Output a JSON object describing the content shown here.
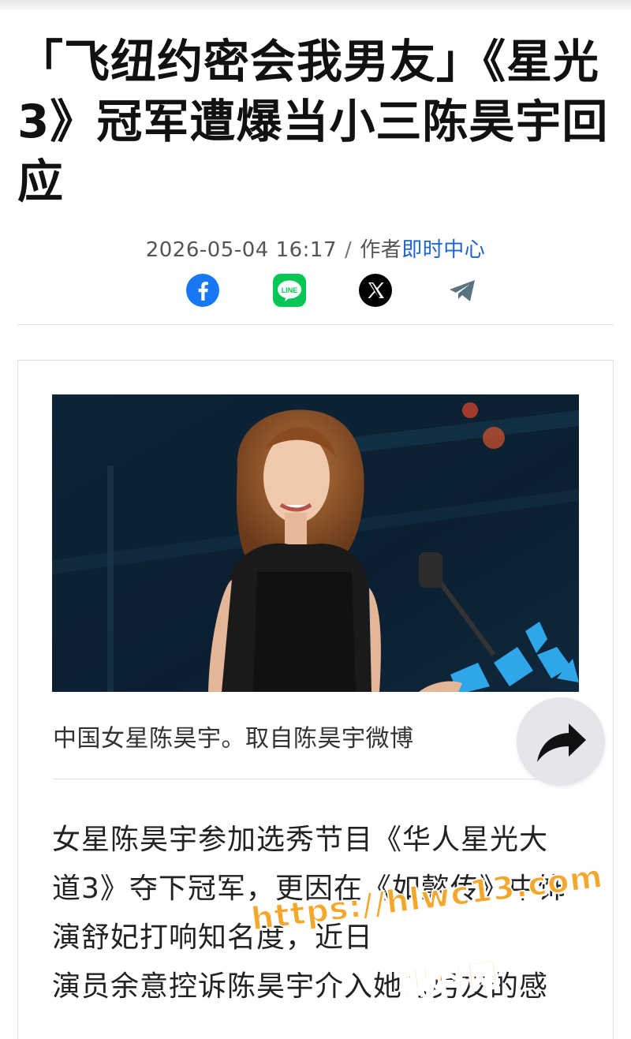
{
  "article": {
    "title": "「飞纽约密会我男友」《星光3》冠军遭爆当小三陈昊宇回应",
    "date": "2026-05-04 16:17",
    "separator": "/",
    "author_prefix": "作者",
    "author": "即时中心"
  },
  "share": {
    "items": [
      {
        "name": "facebook-share",
        "icon": "facebook-icon",
        "color": "#1877f2"
      },
      {
        "name": "line-share",
        "icon": "line-icon",
        "color": "#06c755"
      },
      {
        "name": "x-share",
        "icon": "x-icon",
        "color": "#000000"
      },
      {
        "name": "telegram-share",
        "icon": "telegram-icon",
        "color": "#5b7280"
      }
    ]
  },
  "figure": {
    "caption": "中国女星陈昊宇。取自陈昊宇微博"
  },
  "share_fab": {
    "icon": "share-arrow-icon"
  },
  "body": {
    "lines": [
      "女星陈昊宇参加选秀节目《华人星光大",
      "道3》夺下冠军，更因在《如懿传》中饰",
      "演舒妃打响知名度，近日",
      "演员余意控诉陈昊宇介入她与男友的感"
    ]
  },
  "watermark": {
    "url": "https://hlwc13.com",
    "label": "黑料网"
  }
}
